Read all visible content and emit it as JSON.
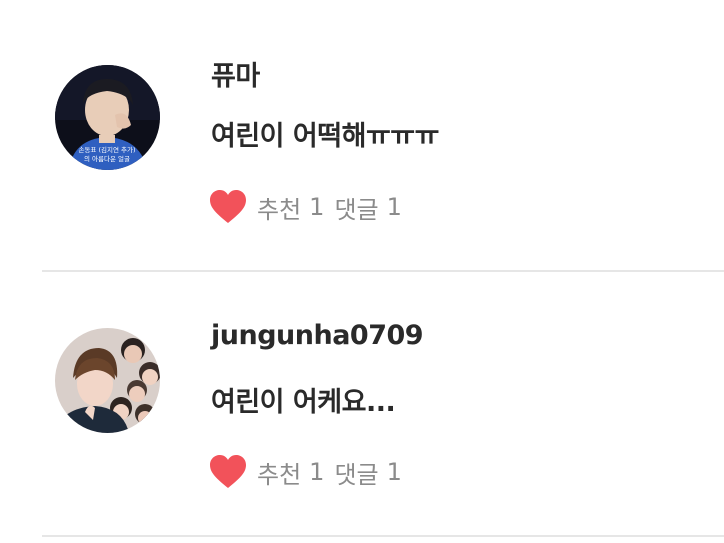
{
  "comments": [
    {
      "username": "퓨마",
      "text": "여린이 어떡해ㅠㅠㅠ",
      "like_label": "추천",
      "like_count": "1",
      "reply_label": "댓글",
      "reply_count": "1",
      "avatar_caption_line1": "손동표 (김지연 추가)",
      "avatar_caption_line2": "의 아름다운 얼굴"
    },
    {
      "username": "jungunha0709",
      "text": "여린이 어케요...",
      "like_label": "추천",
      "like_count": "1",
      "reply_label": "댓글",
      "reply_count": "1"
    }
  ],
  "colors": {
    "heart": "#f2525a",
    "meta_text": "#8b8b8b",
    "divider": "#e6e6e6"
  },
  "icons": {
    "like": "heart-icon"
  }
}
